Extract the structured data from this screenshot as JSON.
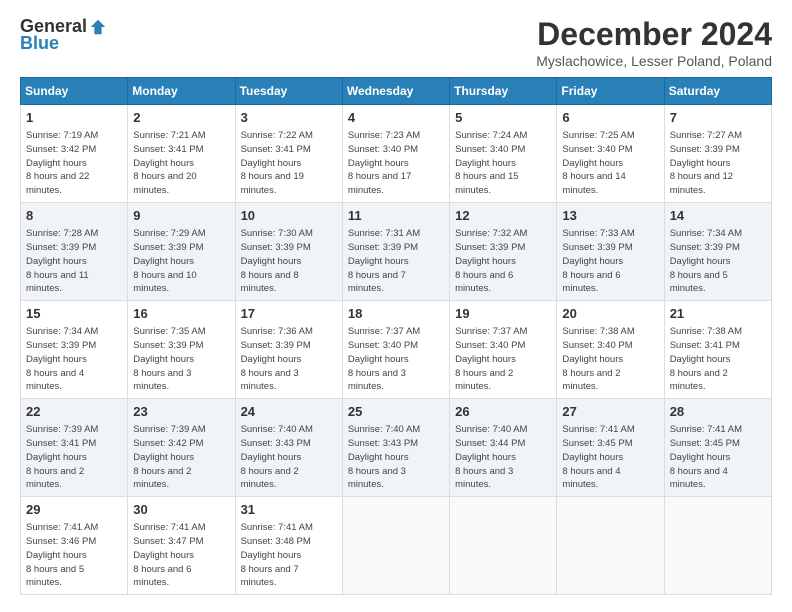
{
  "logo": {
    "general": "General",
    "blue": "Blue"
  },
  "header": {
    "month_title": "December 2024",
    "location": "Myslachowice, Lesser Poland, Poland"
  },
  "days_of_week": [
    "Sunday",
    "Monday",
    "Tuesday",
    "Wednesday",
    "Thursday",
    "Friday",
    "Saturday"
  ],
  "weeks": [
    [
      {
        "day": "1",
        "sunrise": "7:19 AM",
        "sunset": "3:42 PM",
        "daylight": "8 hours and 22 minutes."
      },
      {
        "day": "2",
        "sunrise": "7:21 AM",
        "sunset": "3:41 PM",
        "daylight": "8 hours and 20 minutes."
      },
      {
        "day": "3",
        "sunrise": "7:22 AM",
        "sunset": "3:41 PM",
        "daylight": "8 hours and 19 minutes."
      },
      {
        "day": "4",
        "sunrise": "7:23 AM",
        "sunset": "3:40 PM",
        "daylight": "8 hours and 17 minutes."
      },
      {
        "day": "5",
        "sunrise": "7:24 AM",
        "sunset": "3:40 PM",
        "daylight": "8 hours and 15 minutes."
      },
      {
        "day": "6",
        "sunrise": "7:25 AM",
        "sunset": "3:40 PM",
        "daylight": "8 hours and 14 minutes."
      },
      {
        "day": "7",
        "sunrise": "7:27 AM",
        "sunset": "3:39 PM",
        "daylight": "8 hours and 12 minutes."
      }
    ],
    [
      {
        "day": "8",
        "sunrise": "7:28 AM",
        "sunset": "3:39 PM",
        "daylight": "8 hours and 11 minutes."
      },
      {
        "day": "9",
        "sunrise": "7:29 AM",
        "sunset": "3:39 PM",
        "daylight": "8 hours and 10 minutes."
      },
      {
        "day": "10",
        "sunrise": "7:30 AM",
        "sunset": "3:39 PM",
        "daylight": "8 hours and 8 minutes."
      },
      {
        "day": "11",
        "sunrise": "7:31 AM",
        "sunset": "3:39 PM",
        "daylight": "8 hours and 7 minutes."
      },
      {
        "day": "12",
        "sunrise": "7:32 AM",
        "sunset": "3:39 PM",
        "daylight": "8 hours and 6 minutes."
      },
      {
        "day": "13",
        "sunrise": "7:33 AM",
        "sunset": "3:39 PM",
        "daylight": "8 hours and 6 minutes."
      },
      {
        "day": "14",
        "sunrise": "7:34 AM",
        "sunset": "3:39 PM",
        "daylight": "8 hours and 5 minutes."
      }
    ],
    [
      {
        "day": "15",
        "sunrise": "7:34 AM",
        "sunset": "3:39 PM",
        "daylight": "8 hours and 4 minutes."
      },
      {
        "day": "16",
        "sunrise": "7:35 AM",
        "sunset": "3:39 PM",
        "daylight": "8 hours and 3 minutes."
      },
      {
        "day": "17",
        "sunrise": "7:36 AM",
        "sunset": "3:39 PM",
        "daylight": "8 hours and 3 minutes."
      },
      {
        "day": "18",
        "sunrise": "7:37 AM",
        "sunset": "3:40 PM",
        "daylight": "8 hours and 3 minutes."
      },
      {
        "day": "19",
        "sunrise": "7:37 AM",
        "sunset": "3:40 PM",
        "daylight": "8 hours and 2 minutes."
      },
      {
        "day": "20",
        "sunrise": "7:38 AM",
        "sunset": "3:40 PM",
        "daylight": "8 hours and 2 minutes."
      },
      {
        "day": "21",
        "sunrise": "7:38 AM",
        "sunset": "3:41 PM",
        "daylight": "8 hours and 2 minutes."
      }
    ],
    [
      {
        "day": "22",
        "sunrise": "7:39 AM",
        "sunset": "3:41 PM",
        "daylight": "8 hours and 2 minutes."
      },
      {
        "day": "23",
        "sunrise": "7:39 AM",
        "sunset": "3:42 PM",
        "daylight": "8 hours and 2 minutes."
      },
      {
        "day": "24",
        "sunrise": "7:40 AM",
        "sunset": "3:43 PM",
        "daylight": "8 hours and 2 minutes."
      },
      {
        "day": "25",
        "sunrise": "7:40 AM",
        "sunset": "3:43 PM",
        "daylight": "8 hours and 3 minutes."
      },
      {
        "day": "26",
        "sunrise": "7:40 AM",
        "sunset": "3:44 PM",
        "daylight": "8 hours and 3 minutes."
      },
      {
        "day": "27",
        "sunrise": "7:41 AM",
        "sunset": "3:45 PM",
        "daylight": "8 hours and 4 minutes."
      },
      {
        "day": "28",
        "sunrise": "7:41 AM",
        "sunset": "3:45 PM",
        "daylight": "8 hours and 4 minutes."
      }
    ],
    [
      {
        "day": "29",
        "sunrise": "7:41 AM",
        "sunset": "3:46 PM",
        "daylight": "8 hours and 5 minutes."
      },
      {
        "day": "30",
        "sunrise": "7:41 AM",
        "sunset": "3:47 PM",
        "daylight": "8 hours and 6 minutes."
      },
      {
        "day": "31",
        "sunrise": "7:41 AM",
        "sunset": "3:48 PM",
        "daylight": "8 hours and 7 minutes."
      },
      null,
      null,
      null,
      null
    ]
  ],
  "labels": {
    "sunrise": "Sunrise:",
    "sunset": "Sunset:",
    "daylight": "Daylight hours"
  }
}
